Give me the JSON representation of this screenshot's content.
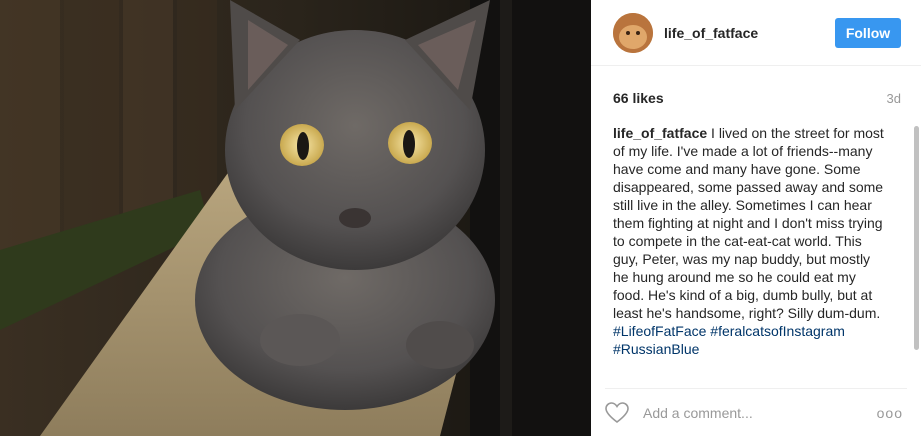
{
  "post": {
    "username": "life_of_fatface",
    "follow_label": "Follow",
    "likes": "66 likes",
    "time_ago": "3d",
    "caption": {
      "username": "life_of_fatface",
      "text": " I lived on the street for most of my life. I've made a lot of friends--many have come and many have gone. Some disappeared, some passed away and some still live in the alley. Sometimes I can hear them fighting at night and I don't miss trying to compete in the cat-eat-cat world. This guy, Peter, was my nap buddy, but mostly he hung around me so he could eat my food. He's kind of a big, dumb bully, but at least he's handsome, right? Silly dum-dum.",
      "hashtags": [
        "#LifeofFatFace",
        "#feralcatsofInstagram",
        "#RussianBlue"
      ]
    },
    "comment_placeholder": "Add a comment...",
    "more_label": "ooo"
  },
  "colors": {
    "follow_bg": "#3897f0",
    "hashtag": "#003569",
    "muted": "#999999"
  },
  "icons": {
    "like": "heart-icon",
    "more": "more-options-icon"
  }
}
